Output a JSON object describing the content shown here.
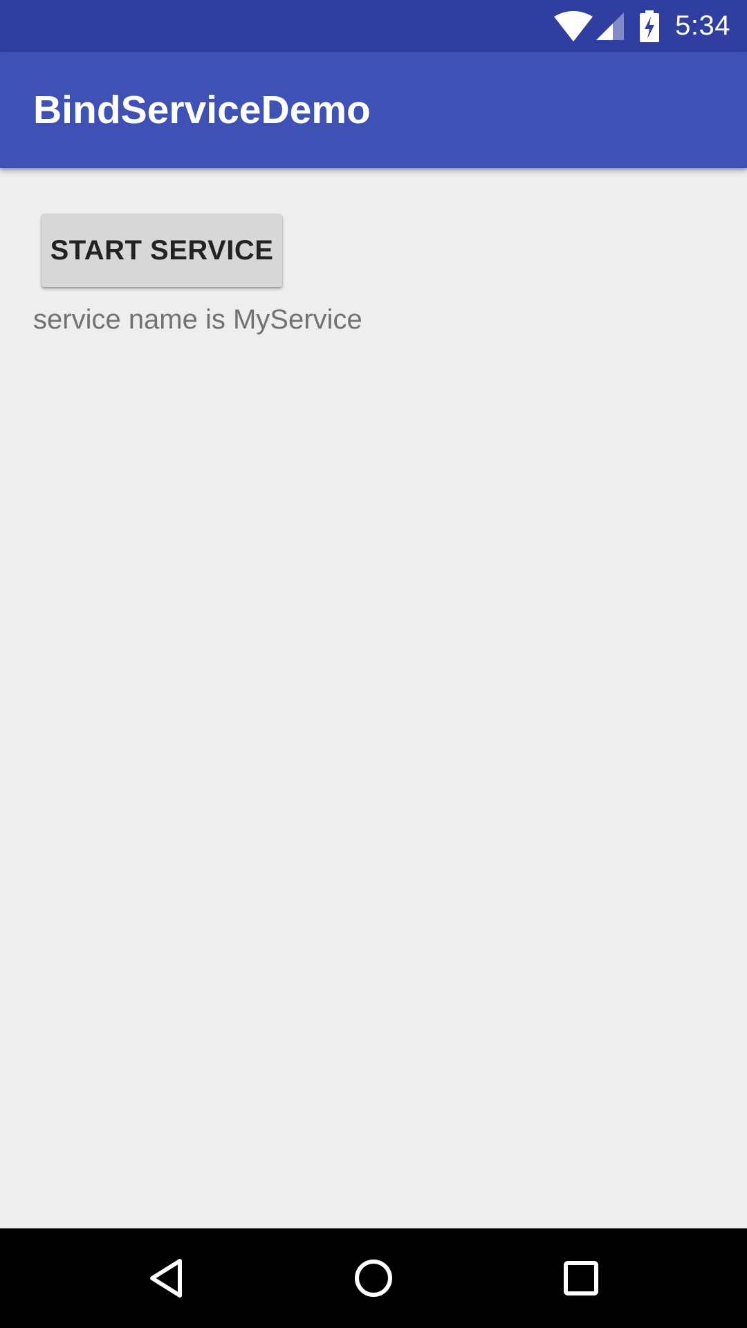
{
  "status_bar": {
    "time": "5:34",
    "icons": [
      "wifi-icon",
      "signal-icon",
      "battery-charging-icon"
    ],
    "background_color": "#303f9f"
  },
  "app_bar": {
    "title": "BindServiceDemo",
    "background_color": "#3f51b5"
  },
  "main": {
    "start_button_label": "START SERVICE",
    "service_text": "service name is MyService"
  },
  "nav_bar": {
    "buttons": [
      "back-icon",
      "home-icon",
      "recents-icon"
    ]
  }
}
